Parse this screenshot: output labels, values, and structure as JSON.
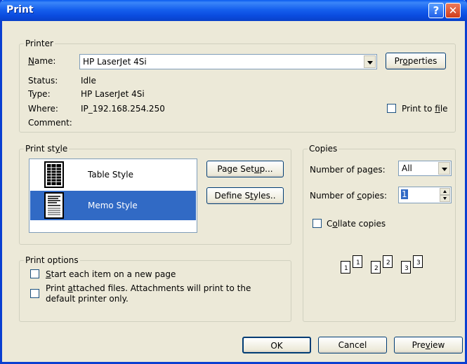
{
  "window": {
    "title": "Print"
  },
  "titlebar": {
    "help_label": "?",
    "close_label": "✕"
  },
  "printer": {
    "legend": "Printer",
    "name_label": "Name:",
    "name_value": "HP LaserJet 4Si",
    "status_label": "Status:",
    "status_value": "Idle",
    "type_label": "Type:",
    "type_value": "HP LaserJet 4Si",
    "where_label": "Where:",
    "where_value": "IP_192.168.254.250",
    "comment_label": "Comment:",
    "properties_label": "Properties",
    "print_to_file_label": "Print to file",
    "print_to_file_checked": false
  },
  "print_style": {
    "legend": "Print style",
    "items": [
      {
        "label": "Table Style",
        "selected": false,
        "icon": "table-style-icon"
      },
      {
        "label": "Memo Style",
        "selected": true,
        "icon": "memo-style-icon"
      }
    ],
    "page_setup_label": "Page Setup...",
    "define_styles_label": "Define Styles.."
  },
  "copies": {
    "legend": "Copies",
    "pages_label": "Number of pages:",
    "pages_value": "All",
    "copies_label": "Number of copies:",
    "copies_value": "1",
    "collate_label": "Collate copies",
    "collate_checked": false,
    "collate_pages": [
      "1",
      "1",
      "2",
      "2",
      "3",
      "3"
    ]
  },
  "print_options": {
    "legend": "Print options",
    "option1_label": "Start each item on a new page",
    "option2_line1": "Print attached files.  Attachments will print to the",
    "option2_line2": "default printer only."
  },
  "footer": {
    "ok_label": "OK",
    "cancel_label": "Cancel",
    "preview_label": "Preview"
  }
}
